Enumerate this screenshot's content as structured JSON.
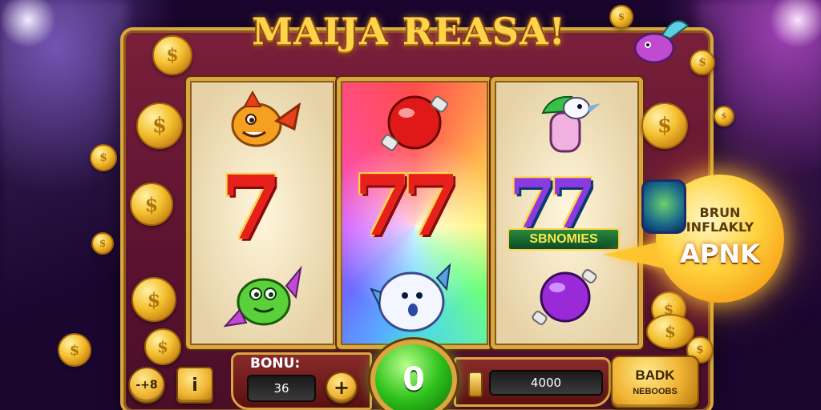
{
  "title": "MAIJA REASA!",
  "reels": {
    "reel1": {
      "symbols": [
        "orange-fish-icon",
        "red-seven",
        "green-fish-icon"
      ],
      "seven": "7"
    },
    "reel2": {
      "symbols": [
        "red-bottle-icon",
        "red-double-seven",
        "white-ghost-icon"
      ],
      "seven": "77"
    },
    "reel3": {
      "symbols": [
        "bird-icon",
        "rainbow-double-seven",
        "purple-bottle-icon"
      ],
      "seven": "77",
      "sign": "SBNOMIES"
    }
  },
  "bubble": {
    "line1": "BRUN",
    "line2": "INFLAKLY",
    "line3": "APNK"
  },
  "controls": {
    "round_btn_label": "-+8",
    "square_btn_label": "i",
    "bonus_label": "BONU:",
    "bonus_value": "36",
    "plus_label": "+",
    "spin_label": "0",
    "credit_value": "4000",
    "back_label_1": "BADK",
    "back_label_2": "NEBOOBS"
  },
  "colors": {
    "gold": "#d9a640",
    "frame": "#6a1834",
    "spin": "#2fc21c",
    "title": "#ffd34a"
  }
}
